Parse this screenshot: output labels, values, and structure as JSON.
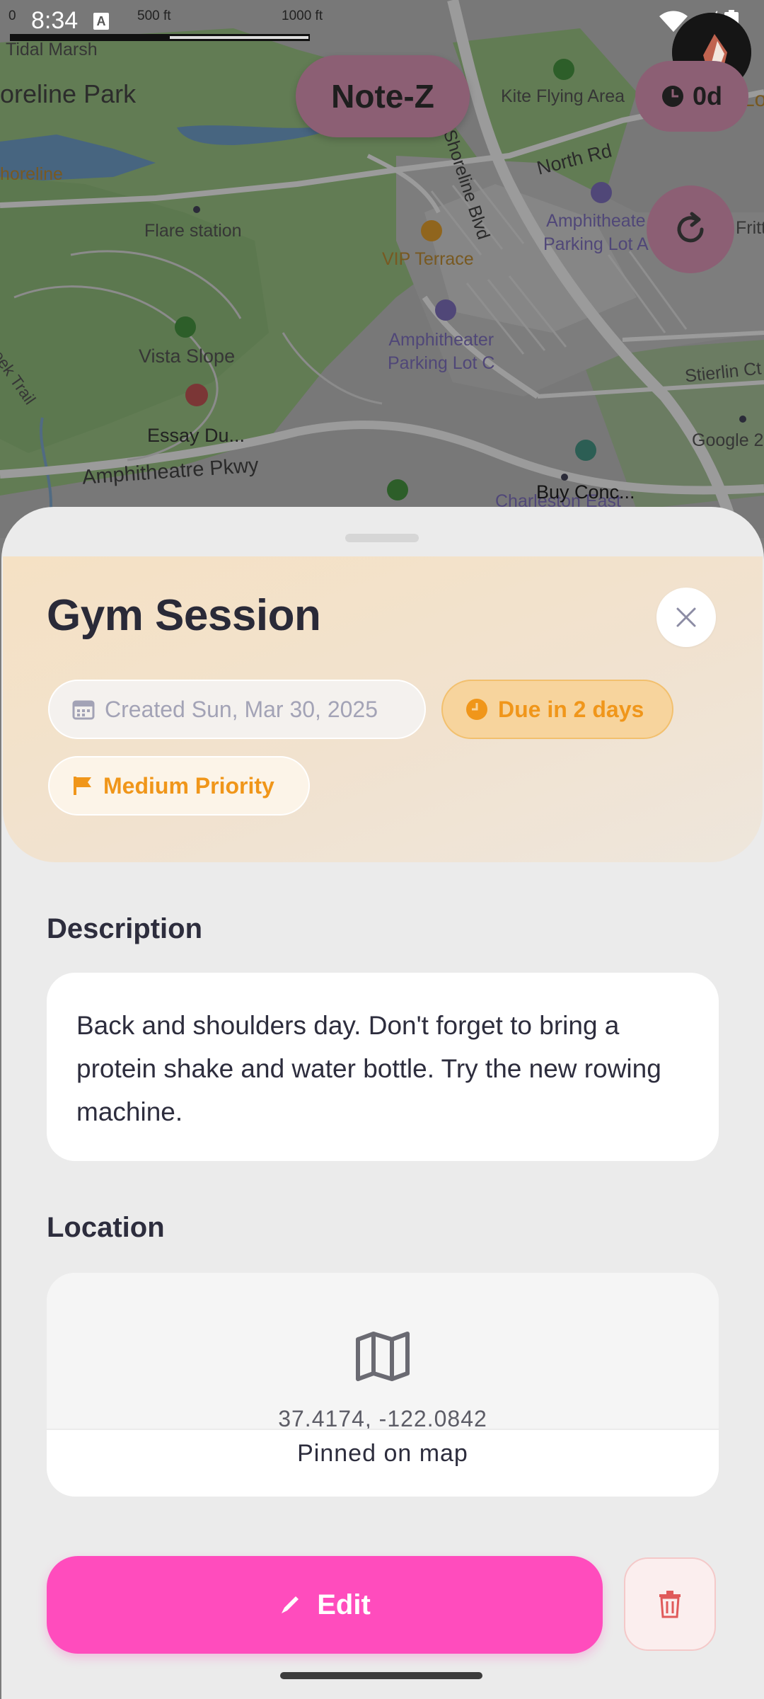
{
  "status_bar": {
    "time": "8:34",
    "notification_glyph": "A",
    "icons": [
      "wifi-icon",
      "signal-icon",
      "battery-icon"
    ]
  },
  "map": {
    "scale_labels": [
      "0",
      "500 ft",
      "1000 ft"
    ],
    "places": {
      "tidal_marsh": "Tidal Marsh",
      "shoreline_park": "oreline Park",
      "shoreline": "horeline",
      "kite_flying_area": "Kite Flying Area",
      "n_shoreline_blvd": "N Shoreline Blvd",
      "north_rd": "North Rd",
      "flare_station": "Flare station",
      "vip_terrace": "VIP Terrace",
      "amphitheater_lot_a": "Amphitheate\nParking Lot A",
      "amphitheater_lot_c": "Amphitheater\nParking Lot C",
      "vista_slope": "Vista Slope",
      "essay_du": "Essay Du...",
      "amphitheatre_pkwy": "Amphitheatre Pkwy",
      "creek_trail": "Creek Trail",
      "stierlin_ct": "Stierlin Ct",
      "google": "Google 2",
      "buy_conc": "Buy Conc...",
      "charleston_east": "Charleston East",
      "fritt": "Fritt",
      "lo": "Lo"
    }
  },
  "overlay": {
    "app_title": "Note-Z",
    "timer_label": "0d"
  },
  "task": {
    "title": "Gym Session",
    "created_chip": "Created Sun, Mar 30, 2025",
    "due_chip": "Due in 2 days",
    "priority_chip": "Medium Priority",
    "description_heading": "Description",
    "description": "Back and shoulders day. Don't forget to bring a protein shake and water bottle. Try the new rowing machine.",
    "location_heading": "Location",
    "coordinates": "37.4174, -122.0842",
    "pinned_label": "Pinned on map",
    "edit_label": "Edit"
  },
  "colors": {
    "accent_pink": "#ff4cbd",
    "due_orange": "#f0961a",
    "header_peach": "#f5e1c4",
    "overlay_mauve": "#8c5f74"
  }
}
